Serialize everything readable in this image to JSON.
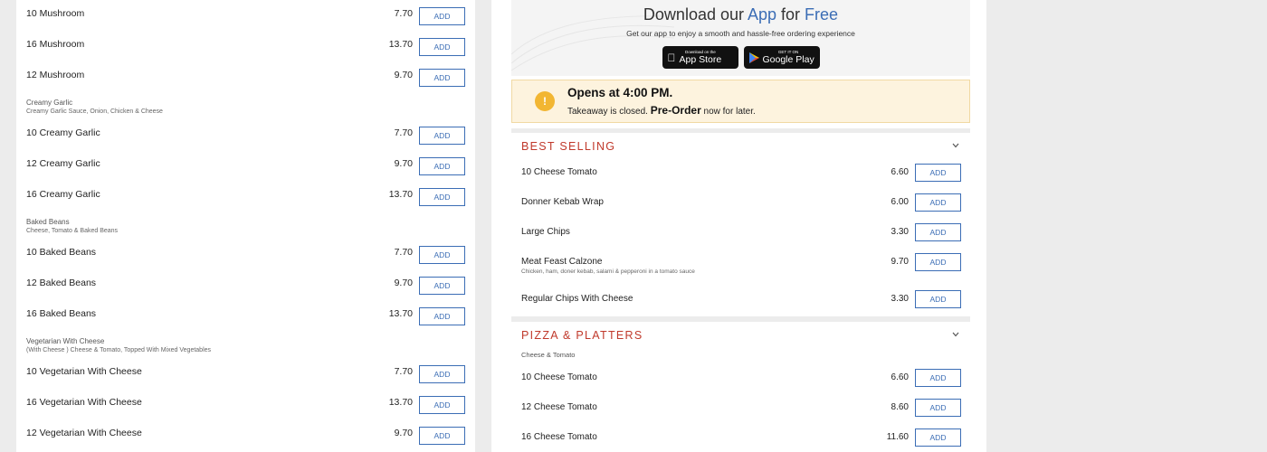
{
  "left": {
    "blocks": [
      {
        "kind": "row",
        "name": "10 Mushroom",
        "price": "7.70"
      },
      {
        "kind": "row",
        "name": "16 Mushroom",
        "price": "13.70"
      },
      {
        "kind": "row",
        "name": "12 Mushroom",
        "price": "9.70"
      },
      {
        "kind": "group",
        "title": "Creamy Garlic",
        "desc": "Creamy Garlic Sauce, Onion, Chicken & Cheese"
      },
      {
        "kind": "row",
        "name": "10 Creamy Garlic",
        "price": "7.70"
      },
      {
        "kind": "row",
        "name": "12 Creamy Garlic",
        "price": "9.70"
      },
      {
        "kind": "row",
        "name": "16 Creamy Garlic",
        "price": "13.70"
      },
      {
        "kind": "group",
        "title": "Baked Beans",
        "desc": "Cheese, Tomato & Baked Beans"
      },
      {
        "kind": "row",
        "name": "10 Baked Beans",
        "price": "7.70"
      },
      {
        "kind": "row",
        "name": "12 Baked Beans",
        "price": "9.70"
      },
      {
        "kind": "row",
        "name": "16 Baked Beans",
        "price": "13.70"
      },
      {
        "kind": "group",
        "title": "Vegetarian With Cheese",
        "desc": "(With Cheese ) Cheese & Tomato, Topped With Mixed Vegetables"
      },
      {
        "kind": "row",
        "name": "10 Vegetarian With Cheese",
        "price": "7.70"
      },
      {
        "kind": "row",
        "name": "16 Vegetarian With Cheese",
        "price": "13.70"
      },
      {
        "kind": "row",
        "name": "12 Vegetarian With Cheese",
        "price": "9.70"
      }
    ]
  },
  "add_label": "ADD",
  "promo": {
    "title_pre": "Download our ",
    "title_app": "App",
    "title_mid": " for ",
    "title_free": "Free",
    "subtitle": "Get our app to enjoy a smooth and hassle-free ordering experience",
    "appstore_small": "Download on the",
    "appstore_big": "App Store",
    "google_small": "GET IT ON",
    "google_big": "Google Play"
  },
  "notice": {
    "icon": "!",
    "title": "Opens at 4:00 PM.",
    "sub_pre": "Takeaway is closed. ",
    "sub_bold": "Pre-Order",
    "sub_post": " now for later."
  },
  "best_selling": {
    "title": "BEST SELLING",
    "items": [
      {
        "name": "10 Cheese Tomato",
        "price": "6.60",
        "desc": ""
      },
      {
        "name": "Donner Kebab Wrap",
        "price": "6.00",
        "desc": ""
      },
      {
        "name": "Large Chips",
        "price": "3.30",
        "desc": ""
      },
      {
        "name": "Meat Feast Calzone",
        "price": "9.70",
        "desc": "Chicken, ham, doner kebab, salami & pepperoni in a tomato sauce"
      },
      {
        "name": "Regular Chips With Cheese",
        "price": "3.30",
        "desc": ""
      }
    ]
  },
  "pizza": {
    "title": "PIZZA & PLATTERS",
    "subtitle": "Cheese & Tomato",
    "items": [
      {
        "name": "10 Cheese Tomato",
        "price": "6.60"
      },
      {
        "name": "12 Cheese Tomato",
        "price": "8.60"
      },
      {
        "name": "16 Cheese Tomato",
        "price": "11.60"
      }
    ]
  },
  "colors": {
    "accent_blue": "#3b6db5",
    "section_red": "#c0392b",
    "notice_bg": "#fdf3de",
    "notice_icon": "#f2b632"
  }
}
